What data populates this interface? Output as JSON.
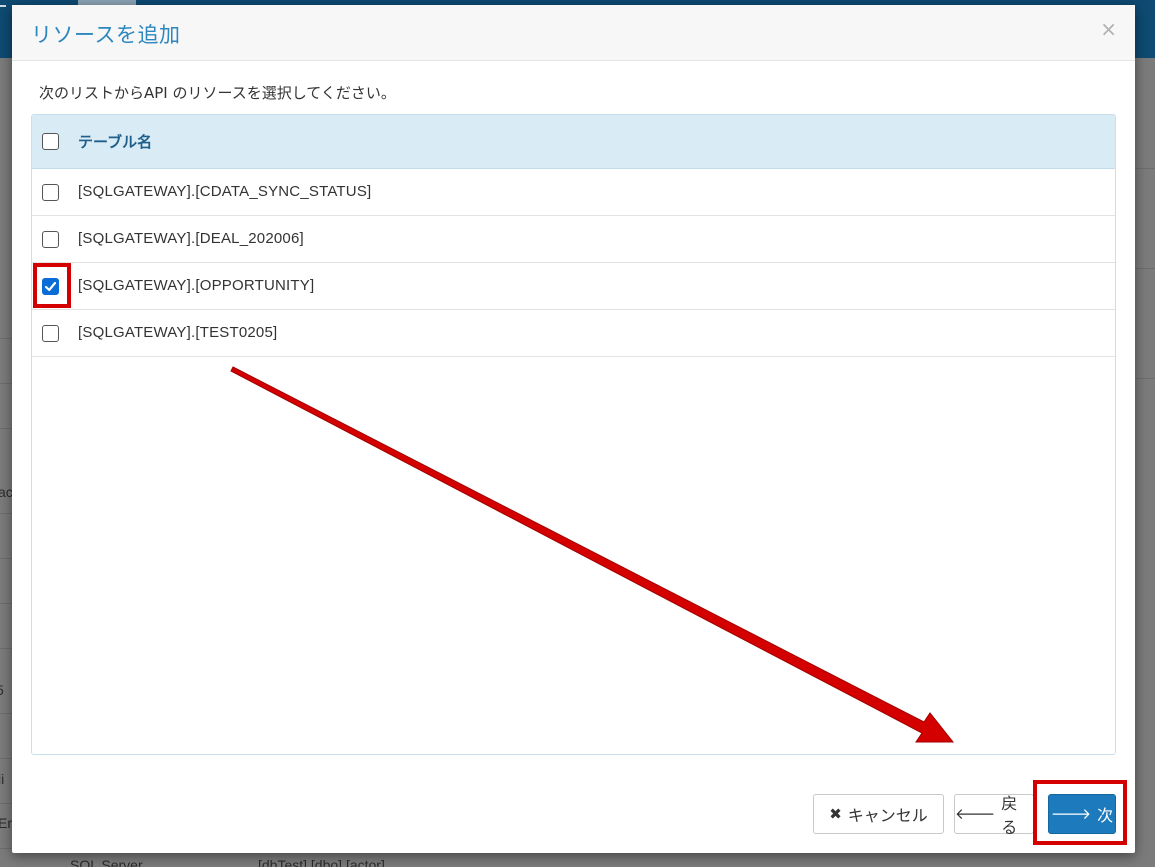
{
  "background": {
    "visible_fragments": [
      "ac",
      "5",
      "ii",
      "Er",
      "SQL Server",
      "[dbTest].[dbo].[actor]"
    ]
  },
  "modal": {
    "title": "リソースを追加",
    "close_glyph": "×",
    "instruction": "次のリストからAPI のリソースを選択してください。",
    "table": {
      "header": "テーブル名",
      "rows": [
        {
          "name": "[SQLGATEWAY].[CDATA_SYNC_STATUS]",
          "checked": false
        },
        {
          "name": "[SQLGATEWAY].[DEAL_202006]",
          "checked": false
        },
        {
          "name": "[SQLGATEWAY].[OPPORTUNITY]",
          "checked": true
        },
        {
          "name": "[SQLGATEWAY].[TEST0205]",
          "checked": false
        }
      ]
    },
    "buttons": {
      "cancel": {
        "label": "キャンセル",
        "icon": "close-icon"
      },
      "back": {
        "label": "戻る",
        "icon": "arrow-left-icon"
      },
      "next": {
        "label": "次",
        "icon": "arrow-right-icon"
      }
    }
  },
  "colors": {
    "title": "#2c87bf",
    "primary": "#1d7bbd",
    "highlight": "#d40000",
    "header_bg": "#d9ebf4"
  }
}
